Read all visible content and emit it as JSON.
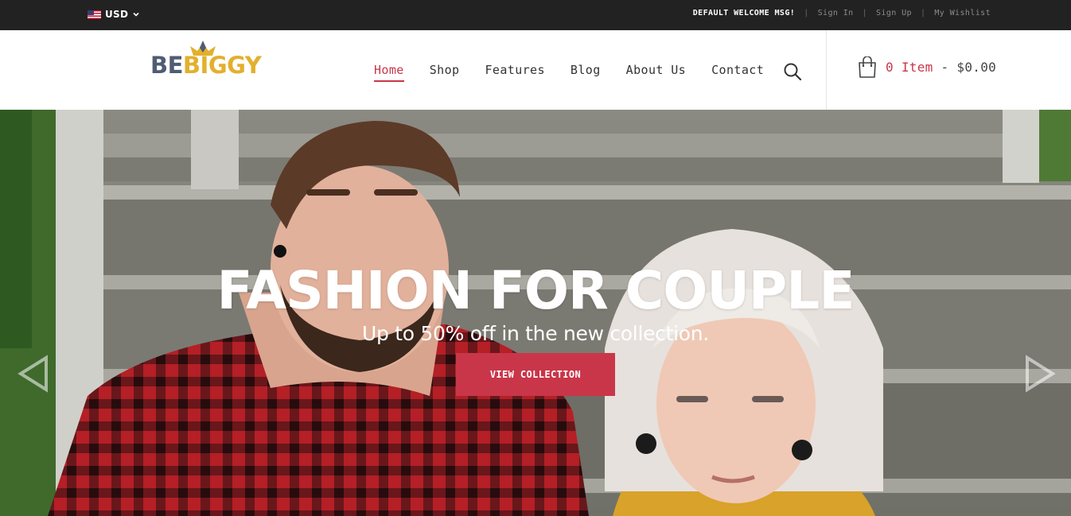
{
  "topbar": {
    "currency": "USD",
    "welcome": "DEFAULT WELCOME MSG!",
    "links": [
      "Sign In",
      "Sign Up",
      "My Wishlist"
    ]
  },
  "header": {
    "logo": {
      "part1": "BE",
      "part2": "BIGGY"
    },
    "nav": [
      {
        "label": "Home",
        "active": true
      },
      {
        "label": "Shop",
        "active": false
      },
      {
        "label": "Features",
        "active": false
      },
      {
        "label": "Blog",
        "active": false
      },
      {
        "label": "About Us",
        "active": false
      },
      {
        "label": "Contact",
        "active": false
      }
    ],
    "cart": {
      "count": "0 Item",
      "separator": "-",
      "total": "$0.00"
    }
  },
  "hero": {
    "title": "FASHION FOR COUPLE",
    "subtitle": "Up to 50% off in the new collection.",
    "button": "VIEW COLLECTION"
  },
  "colors": {
    "accent": "#c93649",
    "topbar_bg": "#222222",
    "logo_dark": "#4f5d73",
    "logo_gold": "#e3b02d"
  },
  "icons": [
    "us-flag-icon",
    "chevron-down-icon",
    "crown-icon",
    "search-icon",
    "shopping-bag-icon",
    "arrow-left-icon",
    "arrow-right-icon"
  ]
}
